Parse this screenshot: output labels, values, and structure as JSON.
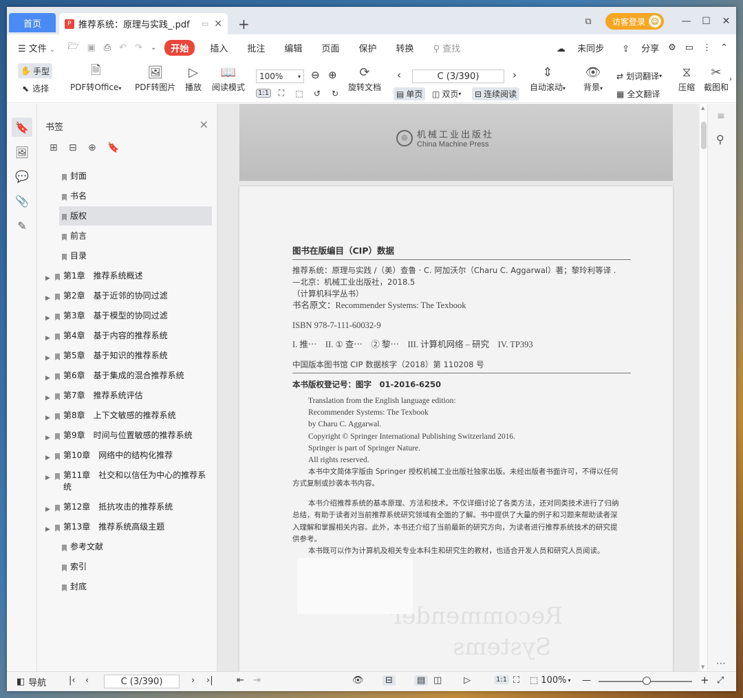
{
  "tabs": {
    "home": "首页",
    "doc_title": "推荐系统：原理与实践_.pdf"
  },
  "titlebar": {
    "login_label": "访客登录"
  },
  "menubar": {
    "file_label": "文件",
    "items": [
      "开始",
      "插入",
      "批注",
      "编辑",
      "页面",
      "保护",
      "转换"
    ],
    "search_placeholder": "查找",
    "sync_label": "未同步",
    "share_label": "分享"
  },
  "ribbon": {
    "hand_label": "手型",
    "select_label": "选择",
    "pdf_to_office": "PDF转Office",
    "pdf_to_image": "PDF转图片",
    "play_label": "播放",
    "read_mode": "阅读模式",
    "zoom_value": "100%",
    "rotate_label": "旋转文档",
    "page_indicator": "C (3/390)",
    "single_page": "单页",
    "double_page": "双页",
    "continuous_read": "连续阅读",
    "auto_scroll": "自动滚动",
    "background_label": "背景",
    "word_translate": "划词翻译",
    "full_translate": "全文翻译",
    "compress_label": "压缩",
    "screenshot_label": "截图和"
  },
  "bookmarks": {
    "title": "书签",
    "items": [
      {
        "label": "封面",
        "expandable": false
      },
      {
        "label": "书名",
        "expandable": false
      },
      {
        "label": "版权",
        "expandable": false,
        "selected": true
      },
      {
        "label": "前言",
        "expandable": false
      },
      {
        "label": "目录",
        "expandable": false
      },
      {
        "label": "第1章　推荐系统概述",
        "expandable": true
      },
      {
        "label": "第2章　基于近邻的协同过滤",
        "expandable": true
      },
      {
        "label": "第3章　基于模型的协同过滤",
        "expandable": true
      },
      {
        "label": "第4章　基于内容的推荐系统",
        "expandable": true
      },
      {
        "label": "第5章　基于知识的推荐系统",
        "expandable": true
      },
      {
        "label": "第6章　基于集成的混合推荐系统",
        "expandable": true
      },
      {
        "label": "第7章　推荐系统评估",
        "expandable": true
      },
      {
        "label": "第8章　上下文敏感的推荐系统",
        "expandable": true
      },
      {
        "label": "第9章　时间与位置敏感的推荐系统",
        "expandable": true
      },
      {
        "label": "第10章　网络中的结构化推荐",
        "expandable": true
      },
      {
        "label": "第11章　社交和以信任为中心的推荐系统",
        "expandable": true
      },
      {
        "label": "第12章　抵抗攻击的推荐系统",
        "expandable": true
      },
      {
        "label": "第13章　推荐系统高级主题",
        "expandable": true
      },
      {
        "label": "参考文献",
        "expandable": false
      },
      {
        "label": "索引",
        "expandable": false
      },
      {
        "label": "封底",
        "expandable": false
      }
    ]
  },
  "page_prev": {
    "publisher_cn": "机械工业出版社",
    "publisher_en": "China Machine Press"
  },
  "page": {
    "cip_heading": "图书在版编目（CIP）数据",
    "cip_line1": "推荐系统：原理与实践 /（美）查鲁 · C. 阿加沃尔（Charu C. Aggarwal）著；黎玲利等译 .",
    "cip_line2": "—北京：机械工业出版社，2018.5",
    "cip_line3": "（计算机科学丛书）",
    "cip_line4": "书名原文：Recommender Systems: The Texbook",
    "isbn": "ISBN 978-7-111-60032-9",
    "classification": "I. 推⋯　II. ① 查⋯　② 黎⋯　III. 计算机网络 – 研究　IV. TP393",
    "cip_approval": "中国版本图书馆 CIP 数据核字（2018）第 110208 号",
    "copyright_reg": "本书版权登记号：图字　01-2016-6250",
    "trans_line1": "Translation from the English language edition:",
    "trans_line2": "Recommender Systems: The Texbook",
    "trans_line3": "by Charu C. Aggarwal.",
    "trans_line4": "Copyright © Springer International Publishing Switzerland 2016.",
    "trans_line5": "Springer is part of Springer Nature.",
    "trans_line6": "All rights reserved.",
    "auth_line1": "本书中文简体字版由 Springer 授权机械工业出版社独家出版。未经出版者书面许可，不得以任何",
    "auth_line2": "方式复制或抄袭本书内容。",
    "intro_line1": "本书介绍推荐系统的基本原理、方法和技术。不仅详细讨论了各类方法，还对同类技术进行了归纳",
    "intro_line2": "总结，有助于读者对当前推荐系统研究领域有全面的了解。书中提供了大量的例子和习题来帮助读者深",
    "intro_line3": "入理解和掌握相关内容。此外，本书还介绍了当前最新的研究方向，为读者进行推荐系统技术的研究提",
    "intro_line4": "供参考。",
    "intro_line5": "本书既可以作为计算机及相关专业本科生和研究生的教材，也适合开发人员和研究人员阅读。",
    "watermark_line1": "Recommender",
    "watermark_line2": "Systems"
  },
  "statusbar": {
    "nav_label": "导航",
    "page_indicator": "C (3/390)",
    "zoom_value": "100%"
  },
  "colors": {
    "accent": "#4a8af4",
    "start_tab": "#e9473a",
    "login": "#f5a623"
  }
}
